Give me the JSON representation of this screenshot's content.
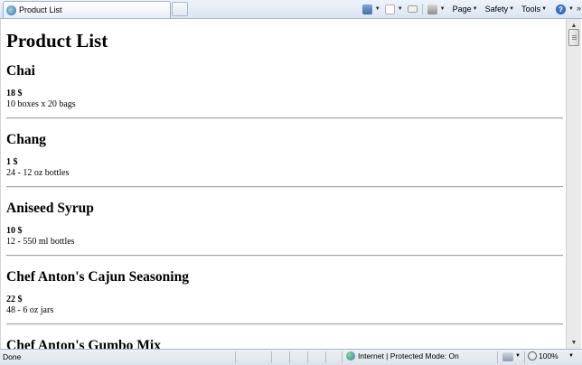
{
  "browser": {
    "tab_title": "Product List",
    "toolbar": {
      "page_label": "Page",
      "safety_label": "Safety",
      "tools_label": "Tools",
      "help_label": "?",
      "more_label": "»",
      "dropdown_arrow": "▼"
    },
    "status": {
      "text": "Done",
      "zone": "Internet | Protected Mode: On",
      "zoom": "100%"
    }
  },
  "page": {
    "title": "Product List",
    "products": [
      {
        "name": "Chai",
        "price": "18 $",
        "quantity": "10 boxes x 20 bags"
      },
      {
        "name": "Chang",
        "price": "1 $",
        "quantity": "24 - 12 oz bottles"
      },
      {
        "name": "Aniseed Syrup",
        "price": "10 $",
        "quantity": "12 - 550 ml bottles"
      },
      {
        "name": "Chef Anton's Cajun Seasoning",
        "price": "22 $",
        "quantity": "48 - 6 oz jars"
      },
      {
        "name": "Chef Anton's Gumbo Mix",
        "price": "",
        "quantity": ""
      }
    ]
  },
  "scrollbar": {
    "position_fraction": 0.0
  }
}
